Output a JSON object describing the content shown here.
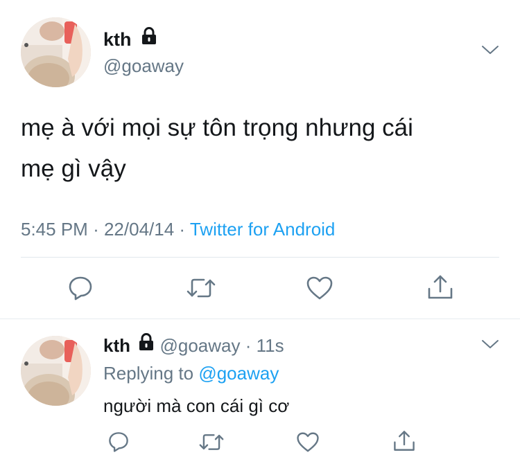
{
  "main_tweet": {
    "display_name": "kth",
    "handle": "@goaway",
    "text_line1": "mẹ à với mọi sự tôn trọng nhưng cái",
    "text_line2": "mẹ gì vậy",
    "time": "5:45 PM",
    "date": "22/04/14",
    "dot1": "·",
    "dot2": "·",
    "source": "Twitter for Android"
  },
  "reply_tweet": {
    "display_name": "kth",
    "handle": "@goaway",
    "dot": "·",
    "age": "11s",
    "replying_label": "Replying to",
    "replying_handle": "@goaway",
    "text": "người mà con cái gì cơ"
  },
  "icons": {
    "lock": "lock-icon",
    "chevron": "chevron-down-icon",
    "reply": "reply-icon",
    "retweet": "retweet-icon",
    "like": "like-icon",
    "share": "share-icon"
  },
  "colors": {
    "text": "#14171a",
    "secondary": "#657786",
    "link": "#1da1f2",
    "icon": "#657786",
    "divider": "#e1e8ed"
  }
}
